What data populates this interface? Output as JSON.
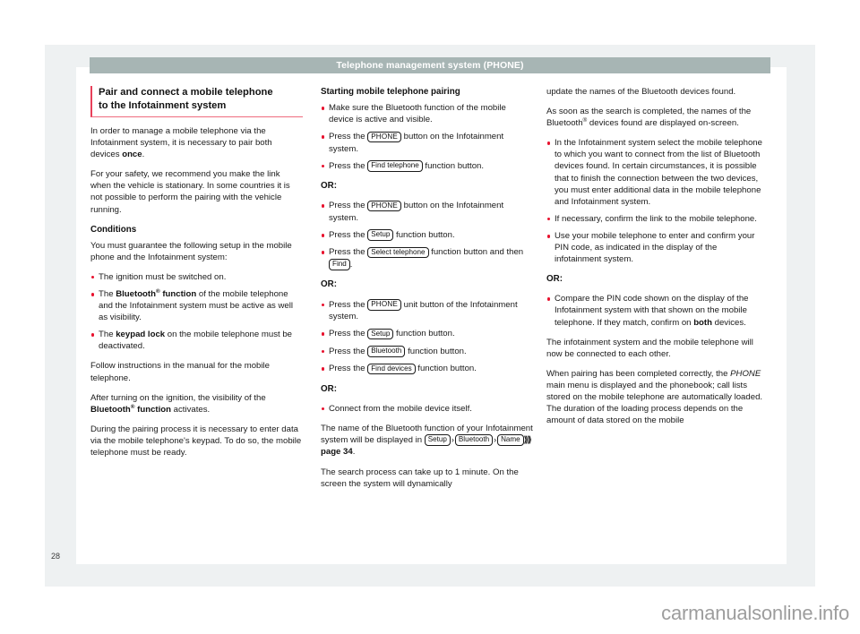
{
  "header": {
    "running_title": "Telephone management system (PHONE)"
  },
  "footer": {
    "page_number": "28",
    "watermark": "carmanualsonline.info"
  },
  "column_1": {
    "section_title_line1": "Pair and connect a mobile telephone",
    "section_title_line2": "to the Infotainment system",
    "para_1_a": "In order to manage a mobile telephone via the Infotainment system, it is necessary to pair both devices ",
    "para_1_bold": "once",
    "para_1_b": ".",
    "para_2": "For your safety, we recommend you make the link when the vehicle is stationary. In some countries it is not possible to perform the pairing with the vehicle running.",
    "conditions_heading": "Conditions",
    "para_3": "You must guarantee the following setup in the mobile phone and the Infotainment system:",
    "bullet_1": "The ignition must be switched on.",
    "bullet_2_a": "The ",
    "bullet_2_bold": "Bluetooth",
    "bullet_2_reg": "®",
    "bullet_2_bold2": " function",
    "bullet_2_b": " of the mobile telephone and the Infotainment system must be active as well as visibility.",
    "bullet_3_a": "The ",
    "bullet_3_bold": "keypad lock",
    "bullet_3_b": " on the mobile telephone must be deactivated.",
    "para_4": "Follow instructions in the manual for the mobile telephone.",
    "para_5_a": "After turning on the ignition, the visibility of the ",
    "para_5_bold": "Bluetooth",
    "para_5_reg": "®",
    "para_5_bold2": " function",
    "para_5_b": " activates.",
    "para_6": "During the pairing process it is necessary to enter data via the mobile telephone's keypad. To do so, the mobile telephone must be ready."
  },
  "column_2": {
    "heading": "Starting mobile telephone pairing",
    "group_1": {
      "bullet_1": "Make sure the Bluetooth function of the mobile device is active and visible.",
      "bullet_2_a": "Press the ",
      "bullet_2_key": "PHONE",
      "bullet_2_b": " button on the Infotainment system.",
      "bullet_3_a": "Press the ",
      "bullet_3_key": "Find telephone",
      "bullet_3_b": " function button."
    },
    "or_label_1": "OR:",
    "group_2": {
      "bullet_1_a": "Press the ",
      "bullet_1_key": "PHONE",
      "bullet_1_b": " button on the Infotainment system.",
      "bullet_2_a": "Press the ",
      "bullet_2_key": "Setup",
      "bullet_2_b": " function button.",
      "bullet_3_a": "Press the ",
      "bullet_3_key": "Select telephone",
      "bullet_3_b": " function button and then ",
      "bullet_3_key2": "Find",
      "bullet_3_c": "."
    },
    "or_label_2": "OR:",
    "group_3": {
      "bullet_1_a": "Press the ",
      "bullet_1_key": "PHONE",
      "bullet_1_b": " unit button of the Infotainment system.",
      "bullet_2_a": "Press the ",
      "bullet_2_key": "Setup",
      "bullet_2_b": " function button.",
      "bullet_3_a": "Press the ",
      "bullet_3_key": "Bluetooth",
      "bullet_3_b": " function button.",
      "bullet_4_a": "Press the ",
      "bullet_4_key": "Find devices",
      "bullet_4_b": " function button."
    },
    "or_label_3": "OR:",
    "group_4": {
      "bullet_1": "Connect from the mobile device itself."
    },
    "para_name_a": "The name of the Bluetooth function of your Infotainment system will be displayed in ",
    "para_name_key1": "Setup",
    "para_name_key2": "Bluetooth",
    "para_name_key3": "Name",
    "para_name_sep": "›",
    "para_name_chevron": "⟫⟫",
    "para_name_ref": "page 34",
    "para_name_end": ".",
    "para_search": "The search process can take up to 1 minute. On the screen the system will dynamically"
  },
  "column_3": {
    "para_1": "update the names of the Bluetooth devices found.",
    "para_2_a": "As soon as the search is completed, the names of the Bluetooth",
    "para_2_reg": "®",
    "para_2_b": " devices found are displayed on-screen.",
    "bullet_1": "In the Infotainment system select the mobile telephone to which you want to connect from the list of Bluetooth devices found. In certain circumstances, it is possible that to finish the connection between the two devices, you must enter additional data in the mobile telephone and Infotainment system.",
    "bullet_2": "If necessary, confirm the link to the mobile telephone.",
    "bullet_3": "Use your mobile telephone to enter and confirm your PIN code, as indicated in the display of the infotainment system.",
    "or_label": "OR:",
    "bullet_4_a": "Compare the PIN code shown on the display of the Infotainment system with that shown on the mobile telephone. If they match, confirm on ",
    "bullet_4_bold": "both",
    "bullet_4_b": " devices.",
    "para_3": "The infotainment system and the mobile telephone will now be connected to each other.",
    "para_4_a": "When pairing has been completed correctly, the ",
    "para_4_italic": "PHONE",
    "para_4_b": " main menu is displayed and the phonebook; call lists stored on the mobile telephone are automatically loaded. The duration of the loading process depends on the amount of data stored on the mobile"
  },
  "colors": {
    "header_band": "#a7b5b4",
    "accent_red": "#e8122e",
    "rule_red": "#ef6c7e",
    "page_backdrop": "#eef1f2"
  }
}
